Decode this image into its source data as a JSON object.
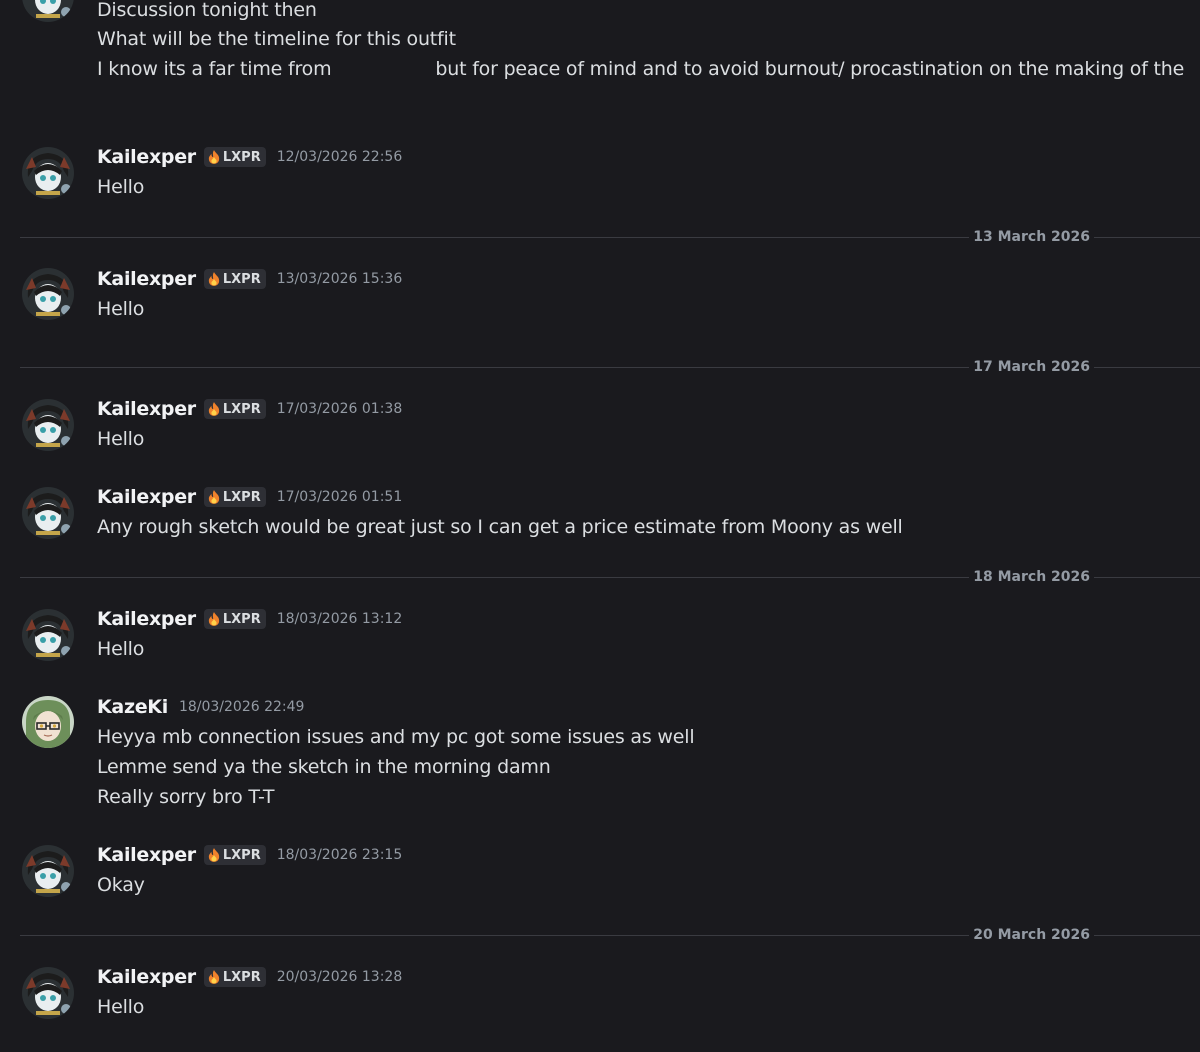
{
  "top_message": {
    "lines": [
      "Discussion tonight then",
      "What will be the timeline for this outfit",
      "I know its a far time from",
      "but for peace of mind and to avoid burnout/ procastination on the making of the"
    ]
  },
  "badge": {
    "label": "LXPR",
    "icon": "flame-icon"
  },
  "dividers": [
    "13 March 2026",
    "17 March 2026",
    "18 March 2026",
    "20 March 2026"
  ],
  "messages": [
    {
      "author": "Kailexper",
      "timestamp": "12/03/2026 22:56",
      "lines": [
        "Hello"
      ]
    },
    {
      "author": "Kailexper",
      "timestamp": "13/03/2026 15:36",
      "lines": [
        "Hello"
      ]
    },
    {
      "author": "Kailexper",
      "timestamp": "17/03/2026 01:38",
      "lines": [
        "Hello"
      ]
    },
    {
      "author": "Kailexper",
      "timestamp": "17/03/2026 01:51",
      "lines": [
        "Any rough sketch would be great just so I can get a price estimate from Moony as well"
      ]
    },
    {
      "author": "Kailexper",
      "timestamp": "18/03/2026 13:12",
      "lines": [
        "Hello"
      ]
    },
    {
      "author": "KazeKi",
      "timestamp": "18/03/2026 22:49",
      "lines": [
        "Heyya mb connection issues and my pc got some issues as well",
        "Lemme send ya the sketch in the morning damn",
        "Really sorry bro T-T"
      ]
    },
    {
      "author": "Kailexper",
      "timestamp": "18/03/2026 23:15",
      "lines": [
        "Okay"
      ]
    },
    {
      "author": "Kailexper",
      "timestamp": "20/03/2026 13:28",
      "lines": [
        "Hello"
      ]
    }
  ],
  "colors": {
    "background": "#1a1a1e",
    "username": "#f2f3f5",
    "text": "#dbdee1",
    "muted": "#949ba4",
    "divider": "#3a3b41",
    "tag_bg": "#2e2f35"
  }
}
